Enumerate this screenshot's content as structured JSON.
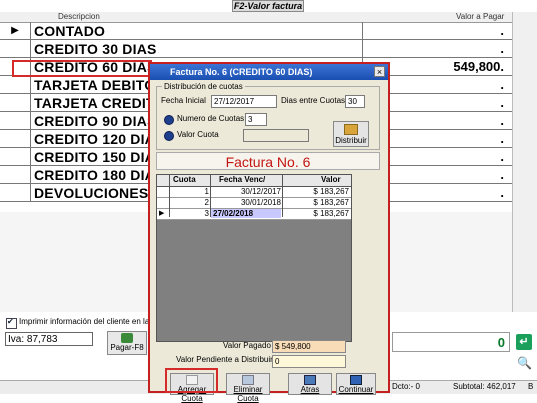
{
  "window_title": "F2-Valor factura",
  "grid": {
    "col_descripcion": "Descripcion",
    "col_valor": "Valor a Pagar",
    "rows": [
      {
        "indicator": "▶",
        "desc": "CONTADO",
        "value": "."
      },
      {
        "indicator": "",
        "desc": "CREDITO 30 DIAS",
        "value": "."
      },
      {
        "indicator": "",
        "desc": "CREDITO 60 DIAS",
        "value": "549,800."
      },
      {
        "indicator": "",
        "desc": "TARJETA DEBITO",
        "value": "."
      },
      {
        "indicator": "",
        "desc": "TARJETA CREDITO",
        "value": "."
      },
      {
        "indicator": "",
        "desc": "CREDITO 90 DIAS",
        "value": "."
      },
      {
        "indicator": "",
        "desc": "CREDITO 120 DIAS",
        "value": "."
      },
      {
        "indicator": "",
        "desc": "CREDITO 150 DIAS",
        "value": "."
      },
      {
        "indicator": "",
        "desc": "CREDITO 180 DIAS",
        "value": "."
      },
      {
        "indicator": "",
        "desc": "DEVOLUCIONES",
        "value": "."
      }
    ]
  },
  "footer": {
    "print_client_label": "Imprimir información del cliente en la fac",
    "iva": "Iva: 87,783",
    "pagar_label": "Pagar-F8",
    "credito_total": "0",
    "status_dcto": "Dcto:- 0",
    "status_subtotal": "Subtotal: 462,017",
    "status_extra": "B"
  },
  "dialog": {
    "title": "Factura No. 6 (CREDITO 60 DIAS)",
    "close": "×",
    "group_label": "Distribución de cuotas",
    "fecha_inicial_label": "Fecha Inicial",
    "fecha_inicial": "27/12/2017",
    "dias_label": "Dias entre Cuotas",
    "dias": "30",
    "numero_cuotas_label": "Numero de Cuotas",
    "numero_cuotas": "3",
    "valor_cuota_label": "Valor Cuota",
    "valor_cuota": "",
    "distribuir_label": "Distribuir",
    "banner": "Factura No. 6",
    "table": {
      "headers": [
        "Cuota",
        "Fecha Venc/",
        "Valor"
      ],
      "rows": [
        {
          "ptr": "",
          "cuota": "1",
          "fecha": "30/12/2017",
          "valor": "$ 183,267"
        },
        {
          "ptr": "",
          "cuota": "2",
          "fecha": "30/01/2018",
          "valor": "$ 183,267"
        },
        {
          "ptr": "▶",
          "cuota": "3",
          "fecha": "27/02/2018",
          "valor": "$ 183,267"
        }
      ]
    },
    "valor_pagado_label": "Valor Pagado",
    "valor_pagado": "$ 549,800",
    "valor_pendiente_label": "Valor Pendiente a Distribuir",
    "valor_pendiente": "0",
    "buttons": {
      "agregar": "Agregar Cuota",
      "eliminar": "Eliminar Cuota",
      "atras": "Atras",
      "continuar": "Continuar"
    }
  }
}
